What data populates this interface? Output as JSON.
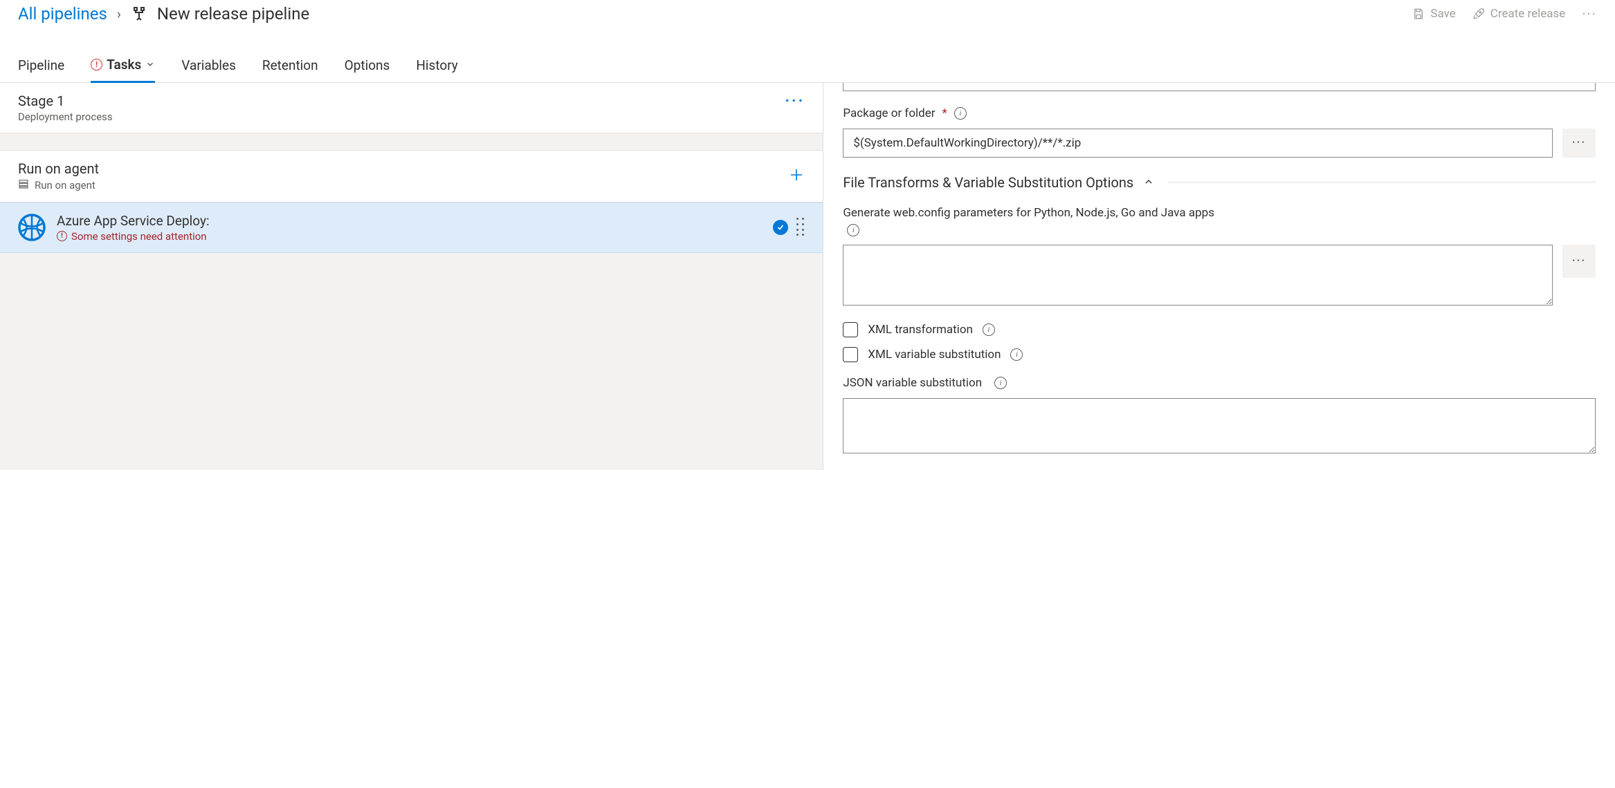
{
  "breadcrumb": {
    "root": "All pipelines",
    "title": "New release pipeline"
  },
  "header_actions": {
    "save": "Save",
    "create_release": "Create release"
  },
  "tabs": {
    "pipeline": "Pipeline",
    "tasks": "Tasks",
    "variables": "Variables",
    "retention": "Retention",
    "options": "Options",
    "history": "History"
  },
  "stage": {
    "title": "Stage 1",
    "subtitle": "Deployment process"
  },
  "agent": {
    "title": "Run on agent",
    "subtitle": "Run on agent"
  },
  "task": {
    "title": "Azure App Service Deploy:",
    "warning": "Some settings need attention"
  },
  "form": {
    "package_label": "Package or folder",
    "package_value": "$(System.DefaultWorkingDirectory)/**/*.zip",
    "section_header": "File Transforms & Variable Substitution Options",
    "webconfig_label": "Generate web.config parameters for Python, Node.js, Go and Java apps",
    "webconfig_value": "",
    "xml_transform": "XML transformation",
    "xml_varsub": "XML variable substitution",
    "json_varsub": "JSON variable substitution",
    "json_value": ""
  }
}
